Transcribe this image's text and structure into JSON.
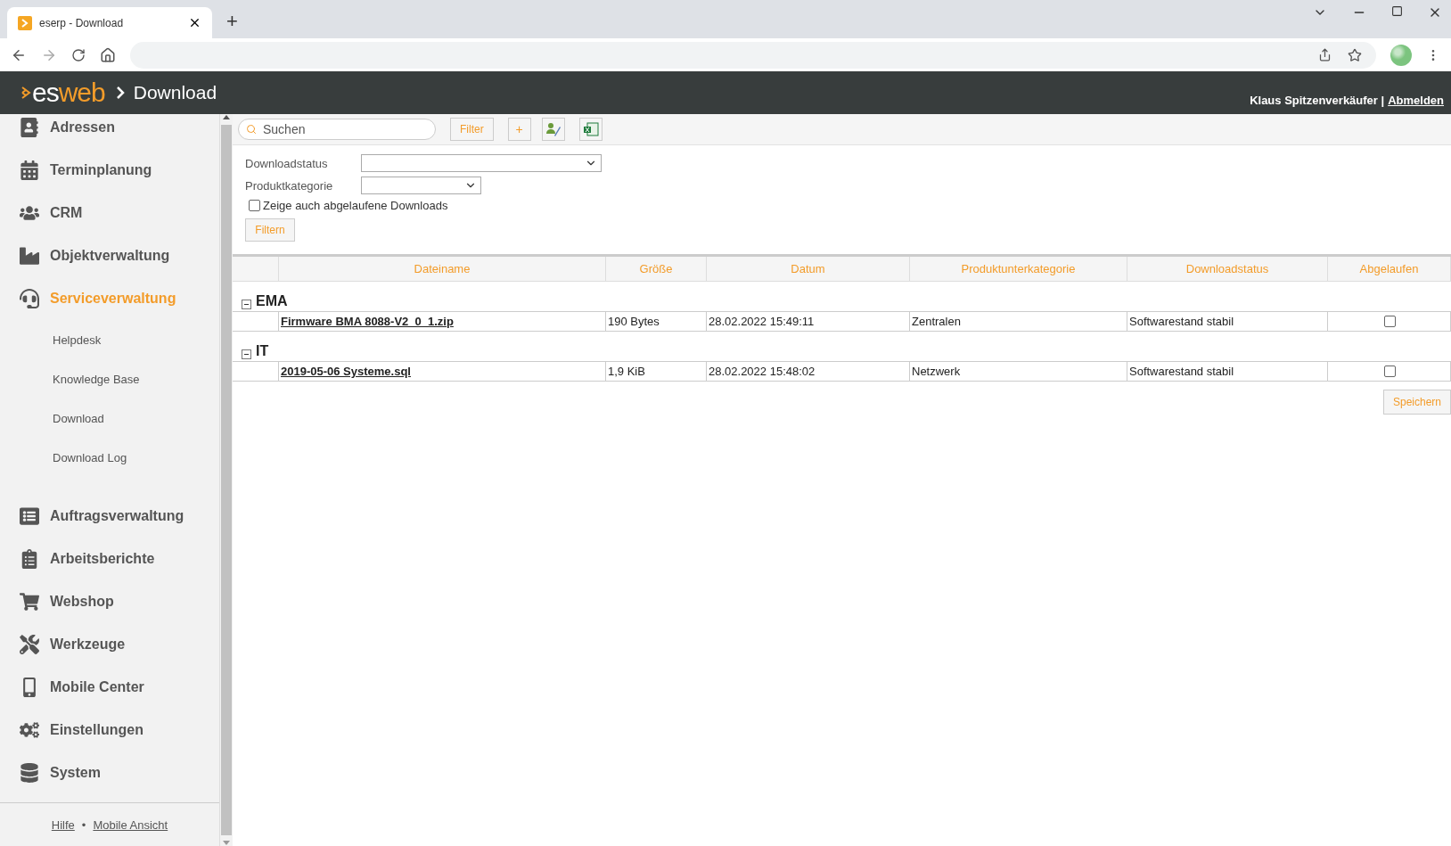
{
  "browser": {
    "tab_title": "eserp - Download",
    "new_tab": "+"
  },
  "header": {
    "logo": {
      "part_1": "es",
      "part_2": "web"
    },
    "breadcrumb": "Download",
    "user": "Klaus Spitzenverkäufer |",
    "logout": "Abmelden"
  },
  "sidebar": {
    "items": [
      {
        "kind": "main",
        "label": "Adressen",
        "selected": false
      },
      {
        "kind": "main",
        "label": "Terminplanung",
        "selected": false
      },
      {
        "kind": "main",
        "label": "CRM",
        "selected": false
      },
      {
        "kind": "main",
        "label": "Objektverwaltung",
        "selected": false
      },
      {
        "kind": "main",
        "label": "Serviceverwaltung",
        "selected": true
      },
      {
        "kind": "sub",
        "label": "Helpdesk",
        "selected": false
      },
      {
        "kind": "sub",
        "label": "Knowledge Base",
        "selected": false
      },
      {
        "kind": "sub",
        "label": "Download",
        "selected": false
      },
      {
        "kind": "sub",
        "label": "Download Log",
        "selected": false
      },
      {
        "kind": "gap"
      },
      {
        "kind": "main",
        "label": "Auftragsverwaltung",
        "selected": false
      },
      {
        "kind": "main",
        "label": "Arbeitsberichte",
        "selected": false
      },
      {
        "kind": "main",
        "label": "Webshop",
        "selected": false
      },
      {
        "kind": "main",
        "label": "Werkzeuge",
        "selected": false
      },
      {
        "kind": "main",
        "label": "Mobile Center",
        "selected": false
      },
      {
        "kind": "main",
        "label": "Einstellungen",
        "selected": false
      },
      {
        "kind": "main",
        "label": "System",
        "selected": false
      }
    ],
    "footer": {
      "links": [
        "Hilfe",
        "Mobile Ansicht"
      ],
      "separator": "•"
    }
  },
  "toolbar": {
    "search": {
      "placeholder": "Suchen"
    },
    "filter_button": "Filter",
    "add_button": "+"
  },
  "filters": {
    "fields": [
      {
        "label": "Downloadstatus"
      },
      {
        "label": "Produktkategorie"
      }
    ],
    "checkbox": {
      "label": "Zeige auch abgelaufene Downloads",
      "checked": false
    },
    "button": "Filtern"
  },
  "table": {
    "columns": [
      "Dateiname",
      "Größe",
      "Datum",
      "Produktunterkategorie",
      "Downloadstatus",
      "Abgelaufen"
    ],
    "groups": [
      {
        "name": "EMA",
        "expanded": true,
        "rows": [
          {
            "file": "Firmware BMA 8088-V2_0_1.zip",
            "size": "190 Bytes",
            "date": "28.02.2022 15:49:11",
            "subcategory": "Zentralen",
            "status": "Softwarestand stabil",
            "expired": false
          }
        ]
      },
      {
        "name": "IT",
        "expanded": true,
        "rows": [
          {
            "file": "2019-05-06 Systeme.sql",
            "size": "1,9 KiB",
            "date": "28.02.2022 15:48:02",
            "subcategory": "Netzwerk",
            "status": "Softwarestand stabil",
            "expired": false
          }
        ]
      }
    ]
  },
  "save_button": "Speichern"
}
